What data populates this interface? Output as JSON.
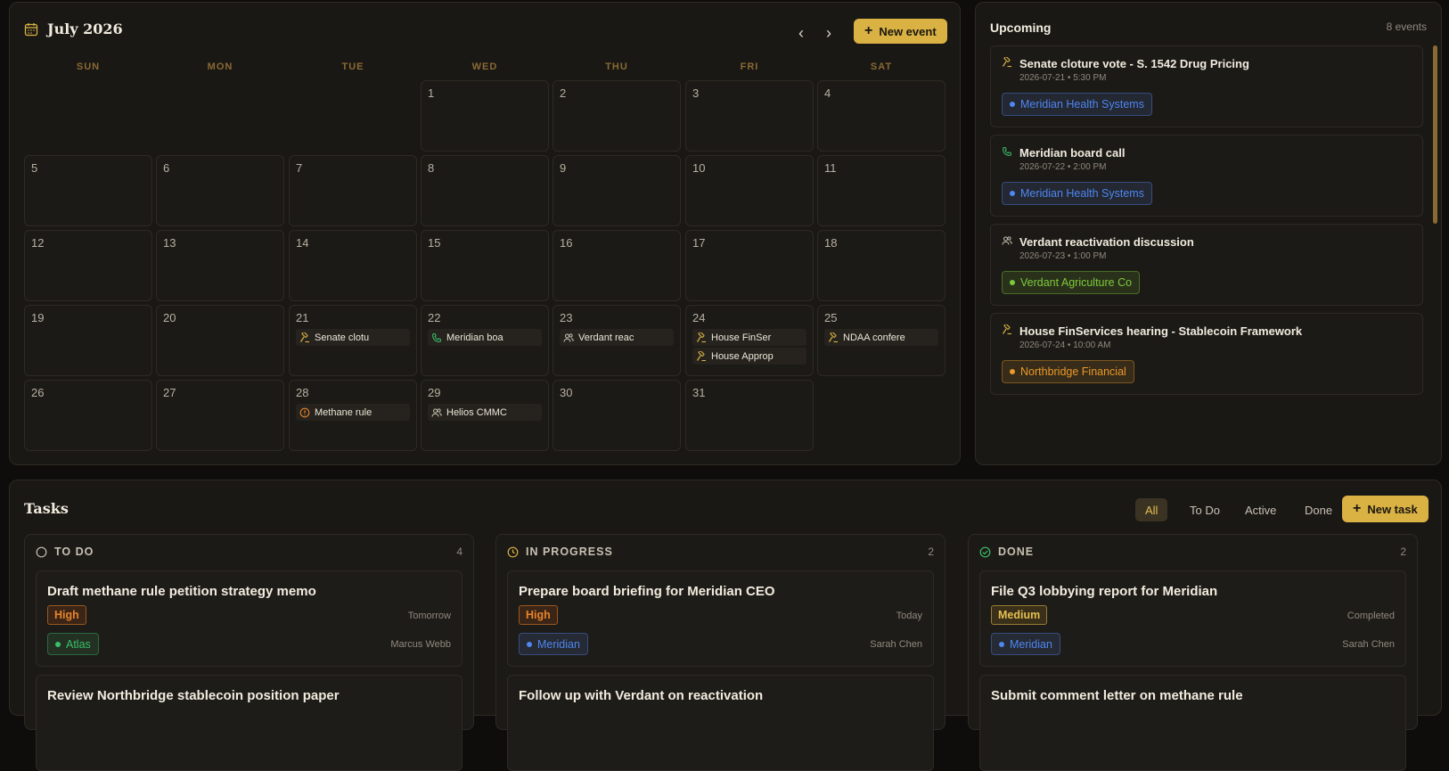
{
  "calendar": {
    "title": "July 2026",
    "prev_icon": "chevron-left-icon",
    "next_icon": "chevron-right-icon",
    "new_event_label": "New event",
    "weekdays": [
      "SUN",
      "MON",
      "TUE",
      "WED",
      "THU",
      "FRI",
      "SAT"
    ],
    "days": [
      "1",
      "2",
      "3",
      "4",
      "5",
      "6",
      "7",
      "8",
      "9",
      "10",
      "11",
      "12",
      "13",
      "14",
      "15",
      "16",
      "17",
      "18",
      "19",
      "20",
      "21",
      "22",
      "23",
      "24",
      "25",
      "26",
      "27",
      "28",
      "29",
      "30",
      "31"
    ],
    "events": {
      "d21": [
        {
          "icon": "gavel-icon",
          "label": "Senate clotu"
        }
      ],
      "d22": [
        {
          "icon": "phone-icon",
          "label": "Meridian boa"
        }
      ],
      "d23": [
        {
          "icon": "users-icon",
          "label": "Verdant reac"
        }
      ],
      "d24": [
        {
          "icon": "gavel-icon",
          "label": "House FinSer"
        },
        {
          "icon": "gavel-icon",
          "label": "House Approp"
        }
      ],
      "d25": [
        {
          "icon": "gavel-icon",
          "label": "NDAA confere"
        }
      ],
      "d28": [
        {
          "icon": "alert-circle-icon",
          "label": "Methane rule"
        }
      ],
      "d29": [
        {
          "icon": "users-icon",
          "label": "Helios CMMC"
        }
      ]
    }
  },
  "upcoming": {
    "title": "Upcoming",
    "count": "8 events",
    "items": [
      {
        "icon": "gavel-icon",
        "title": "Senate cloture vote - S. 1542 Drug Pricing",
        "when": "2026-07-21 • 5:30 PM",
        "client": "Meridian Health Systems",
        "color": "#4f86f0"
      },
      {
        "icon": "phone-icon",
        "title": "Meridian board call",
        "when": "2026-07-22 • 2:00 PM",
        "client": "Meridian Health Systems",
        "color": "#4f86f0"
      },
      {
        "icon": "users-icon",
        "title": "Verdant reactivation discussion",
        "when": "2026-07-23 • 1:00 PM",
        "client": "Verdant Agriculture Co",
        "color": "#7ec93a"
      },
      {
        "icon": "gavel-icon",
        "title": "House FinServices hearing - Stablecoin Framework",
        "when": "2026-07-24 • 10:00 AM",
        "client": "Northbridge Financial",
        "color": "#e89a2a"
      }
    ]
  },
  "tasks": {
    "title": "Tasks",
    "filters": [
      "All",
      "To Do",
      "Active",
      "Done"
    ],
    "new_task_label": "New task",
    "columns": [
      {
        "icon": "circle-icon",
        "title": "TO DO",
        "count": "4",
        "cards": [
          {
            "title": "Draft methane rule petition strategy memo",
            "priority": "High",
            "due": "Tomorrow",
            "client": "Atlas",
            "owner": "Marcus Webb"
          },
          {
            "title": "Review Northbridge stablecoin position paper"
          }
        ]
      },
      {
        "icon": "clock-icon",
        "title": "IN PROGRESS",
        "count": "2",
        "cards": [
          {
            "title": "Prepare board briefing for Meridian CEO",
            "priority": "High",
            "due": "Today",
            "client": "Meridian",
            "owner": "Sarah Chen"
          },
          {
            "title": "Follow up with Verdant on reactivation"
          }
        ]
      },
      {
        "icon": "check-circle-icon",
        "title": "DONE",
        "count": "2",
        "cards": [
          {
            "title": "File Q3 lobbying report for Meridian",
            "priority": "Medium",
            "due": "Completed",
            "client": "Meridian",
            "owner": "Sarah Chen"
          },
          {
            "title": "Submit comment letter on methane rule"
          }
        ]
      }
    ]
  },
  "colors": {
    "accent": "#d9b243",
    "bg": "#0e0d0b",
    "panel": "#1a1815"
  }
}
